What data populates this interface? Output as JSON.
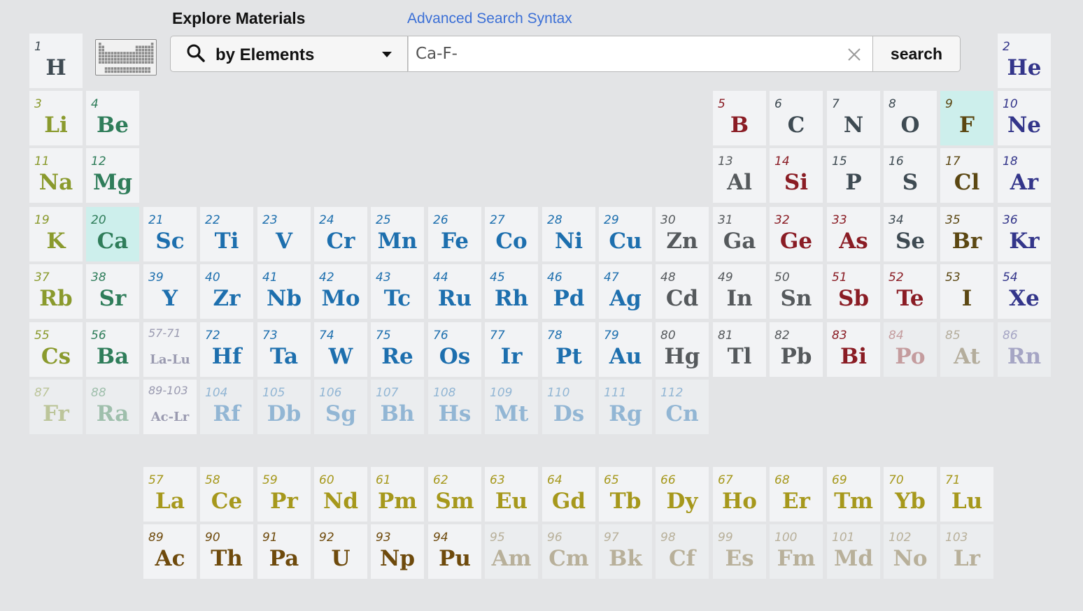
{
  "header": {
    "title": "Explore Materials",
    "advanced_link": "Advanced Search Syntax"
  },
  "search": {
    "mode_label": "by Elements",
    "query": "Ca-F-",
    "button_label": "search"
  },
  "colors": {
    "selected_bg": "#cdefec",
    "link": "#3b6fd6"
  },
  "elements": [
    {
      "num": "1",
      "sym": "H",
      "row": 0,
      "col": 0,
      "color": "#3e4a52"
    },
    {
      "num": "2",
      "sym": "He",
      "row": 0,
      "col": 17,
      "color": "#33358a"
    },
    {
      "num": "3",
      "sym": "Li",
      "row": 1,
      "col": 0,
      "color": "#8a9a2d"
    },
    {
      "num": "4",
      "sym": "Be",
      "row": 1,
      "col": 1,
      "color": "#2f7d5a"
    },
    {
      "num": "5",
      "sym": "B",
      "row": 1,
      "col": 12,
      "color": "#8a1c24"
    },
    {
      "num": "6",
      "sym": "C",
      "row": 1,
      "col": 13,
      "color": "#3e4a52"
    },
    {
      "num": "7",
      "sym": "N",
      "row": 1,
      "col": 14,
      "color": "#3e4a52"
    },
    {
      "num": "8",
      "sym": "O",
      "row": 1,
      "col": 15,
      "color": "#3e4a52"
    },
    {
      "num": "9",
      "sym": "F",
      "row": 1,
      "col": 16,
      "color": "#5b4712",
      "selected": true
    },
    {
      "num": "10",
      "sym": "Ne",
      "row": 1,
      "col": 17,
      "color": "#33358a"
    },
    {
      "num": "11",
      "sym": "Na",
      "row": 2,
      "col": 0,
      "color": "#8a9a2d"
    },
    {
      "num": "12",
      "sym": "Mg",
      "row": 2,
      "col": 1,
      "color": "#2f7d5a"
    },
    {
      "num": "13",
      "sym": "Al",
      "row": 2,
      "col": 12,
      "color": "#55595c"
    },
    {
      "num": "14",
      "sym": "Si",
      "row": 2,
      "col": 13,
      "color": "#8a1c24"
    },
    {
      "num": "15",
      "sym": "P",
      "row": 2,
      "col": 14,
      "color": "#3e4a52"
    },
    {
      "num": "16",
      "sym": "S",
      "row": 2,
      "col": 15,
      "color": "#3e4a52"
    },
    {
      "num": "17",
      "sym": "Cl",
      "row": 2,
      "col": 16,
      "color": "#5b4712"
    },
    {
      "num": "18",
      "sym": "Ar",
      "row": 2,
      "col": 17,
      "color": "#33358a"
    },
    {
      "num": "19",
      "sym": "K",
      "row": 3,
      "col": 0,
      "color": "#8a9a2d"
    },
    {
      "num": "20",
      "sym": "Ca",
      "row": 3,
      "col": 1,
      "color": "#2f7d5a",
      "selected": true
    },
    {
      "num": "21",
      "sym": "Sc",
      "row": 3,
      "col": 2,
      "color": "#1d6fae"
    },
    {
      "num": "22",
      "sym": "Ti",
      "row": 3,
      "col": 3,
      "color": "#1d6fae"
    },
    {
      "num": "23",
      "sym": "V",
      "row": 3,
      "col": 4,
      "color": "#1d6fae"
    },
    {
      "num": "24",
      "sym": "Cr",
      "row": 3,
      "col": 5,
      "color": "#1d6fae"
    },
    {
      "num": "25",
      "sym": "Mn",
      "row": 3,
      "col": 6,
      "color": "#1d6fae"
    },
    {
      "num": "26",
      "sym": "Fe",
      "row": 3,
      "col": 7,
      "color": "#1d6fae"
    },
    {
      "num": "27",
      "sym": "Co",
      "row": 3,
      "col": 8,
      "color": "#1d6fae"
    },
    {
      "num": "28",
      "sym": "Ni",
      "row": 3,
      "col": 9,
      "color": "#1d6fae"
    },
    {
      "num": "29",
      "sym": "Cu",
      "row": 3,
      "col": 10,
      "color": "#1d6fae"
    },
    {
      "num": "30",
      "sym": "Zn",
      "row": 3,
      "col": 11,
      "color": "#55595c"
    },
    {
      "num": "31",
      "sym": "Ga",
      "row": 3,
      "col": 12,
      "color": "#55595c"
    },
    {
      "num": "32",
      "sym": "Ge",
      "row": 3,
      "col": 13,
      "color": "#8a1c24"
    },
    {
      "num": "33",
      "sym": "As",
      "row": 3,
      "col": 14,
      "color": "#8a1c24"
    },
    {
      "num": "34",
      "sym": "Se",
      "row": 3,
      "col": 15,
      "color": "#3e4a52"
    },
    {
      "num": "35",
      "sym": "Br",
      "row": 3,
      "col": 16,
      "color": "#5b4712"
    },
    {
      "num": "36",
      "sym": "Kr",
      "row": 3,
      "col": 17,
      "color": "#33358a"
    },
    {
      "num": "37",
      "sym": "Rb",
      "row": 4,
      "col": 0,
      "color": "#8a9a2d"
    },
    {
      "num": "38",
      "sym": "Sr",
      "row": 4,
      "col": 1,
      "color": "#2f7d5a"
    },
    {
      "num": "39",
      "sym": "Y",
      "row": 4,
      "col": 2,
      "color": "#1d6fae"
    },
    {
      "num": "40",
      "sym": "Zr",
      "row": 4,
      "col": 3,
      "color": "#1d6fae"
    },
    {
      "num": "41",
      "sym": "Nb",
      "row": 4,
      "col": 4,
      "color": "#1d6fae"
    },
    {
      "num": "42",
      "sym": "Mo",
      "row": 4,
      "col": 5,
      "color": "#1d6fae"
    },
    {
      "num": "43",
      "sym": "Tc",
      "row": 4,
      "col": 6,
      "color": "#1d6fae"
    },
    {
      "num": "44",
      "sym": "Ru",
      "row": 4,
      "col": 7,
      "color": "#1d6fae"
    },
    {
      "num": "45",
      "sym": "Rh",
      "row": 4,
      "col": 8,
      "color": "#1d6fae"
    },
    {
      "num": "46",
      "sym": "Pd",
      "row": 4,
      "col": 9,
      "color": "#1d6fae"
    },
    {
      "num": "47",
      "sym": "Ag",
      "row": 4,
      "col": 10,
      "color": "#1d6fae"
    },
    {
      "num": "48",
      "sym": "Cd",
      "row": 4,
      "col": 11,
      "color": "#55595c"
    },
    {
      "num": "49",
      "sym": "In",
      "row": 4,
      "col": 12,
      "color": "#55595c"
    },
    {
      "num": "50",
      "sym": "Sn",
      "row": 4,
      "col": 13,
      "color": "#55595c"
    },
    {
      "num": "51",
      "sym": "Sb",
      "row": 4,
      "col": 14,
      "color": "#8a1c24"
    },
    {
      "num": "52",
      "sym": "Te",
      "row": 4,
      "col": 15,
      "color": "#8a1c24"
    },
    {
      "num": "53",
      "sym": "I",
      "row": 4,
      "col": 16,
      "color": "#5b4712"
    },
    {
      "num": "54",
      "sym": "Xe",
      "row": 4,
      "col": 17,
      "color": "#33358a"
    },
    {
      "num": "55",
      "sym": "Cs",
      "row": 5,
      "col": 0,
      "color": "#8a9a2d"
    },
    {
      "num": "56",
      "sym": "Ba",
      "row": 5,
      "col": 1,
      "color": "#2f7d5a"
    },
    {
      "num": "57-71",
      "sym": "La-Lu",
      "row": 5,
      "col": 2,
      "color": "#9a9ab0",
      "range": true
    },
    {
      "num": "72",
      "sym": "Hf",
      "row": 5,
      "col": 3,
      "color": "#1d6fae"
    },
    {
      "num": "73",
      "sym": "Ta",
      "row": 5,
      "col": 4,
      "color": "#1d6fae"
    },
    {
      "num": "74",
      "sym": "W",
      "row": 5,
      "col": 5,
      "color": "#1d6fae"
    },
    {
      "num": "75",
      "sym": "Re",
      "row": 5,
      "col": 6,
      "color": "#1d6fae"
    },
    {
      "num": "76",
      "sym": "Os",
      "row": 5,
      "col": 7,
      "color": "#1d6fae"
    },
    {
      "num": "77",
      "sym": "Ir",
      "row": 5,
      "col": 8,
      "color": "#1d6fae"
    },
    {
      "num": "78",
      "sym": "Pt",
      "row": 5,
      "col": 9,
      "color": "#1d6fae"
    },
    {
      "num": "79",
      "sym": "Au",
      "row": 5,
      "col": 10,
      "color": "#1d6fae"
    },
    {
      "num": "80",
      "sym": "Hg",
      "row": 5,
      "col": 11,
      "color": "#55595c"
    },
    {
      "num": "81",
      "sym": "Tl",
      "row": 5,
      "col": 12,
      "color": "#55595c"
    },
    {
      "num": "82",
      "sym": "Pb",
      "row": 5,
      "col": 13,
      "color": "#55595c"
    },
    {
      "num": "83",
      "sym": "Bi",
      "row": 5,
      "col": 14,
      "color": "#8a1c24"
    },
    {
      "num": "84",
      "sym": "Po",
      "row": 5,
      "col": 15,
      "color": "#c49c9e",
      "faded": true
    },
    {
      "num": "85",
      "sym": "At",
      "row": 5,
      "col": 16,
      "color": "#b4ad9c",
      "faded": true
    },
    {
      "num": "86",
      "sym": "Rn",
      "row": 5,
      "col": 17,
      "color": "#a5a5c4",
      "faded": true
    },
    {
      "num": "87",
      "sym": "Fr",
      "row": 6,
      "col": 0,
      "color": "#bcc59a",
      "faded": true
    },
    {
      "num": "88",
      "sym": "Ra",
      "row": 6,
      "col": 1,
      "color": "#9fbfac",
      "faded": true
    },
    {
      "num": "89-103",
      "sym": "Ac-Lr",
      "row": 6,
      "col": 2,
      "color": "#9a9ab0",
      "range": true
    },
    {
      "num": "104",
      "sym": "Rf",
      "row": 6,
      "col": 3,
      "color": "#92b6d4",
      "faded": true
    },
    {
      "num": "105",
      "sym": "Db",
      "row": 6,
      "col": 4,
      "color": "#92b6d4",
      "faded": true
    },
    {
      "num": "106",
      "sym": "Sg",
      "row": 6,
      "col": 5,
      "color": "#92b6d4",
      "faded": true
    },
    {
      "num": "107",
      "sym": "Bh",
      "row": 6,
      "col": 6,
      "color": "#92b6d4",
      "faded": true
    },
    {
      "num": "108",
      "sym": "Hs",
      "row": 6,
      "col": 7,
      "color": "#92b6d4",
      "faded": true
    },
    {
      "num": "109",
      "sym": "Mt",
      "row": 6,
      "col": 8,
      "color": "#92b6d4",
      "faded": true
    },
    {
      "num": "110",
      "sym": "Ds",
      "row": 6,
      "col": 9,
      "color": "#92b6d4",
      "faded": true
    },
    {
      "num": "111",
      "sym": "Rg",
      "row": 6,
      "col": 10,
      "color": "#92b6d4",
      "faded": true
    },
    {
      "num": "112",
      "sym": "Cn",
      "row": 6,
      "col": 11,
      "color": "#92b6d4",
      "faded": true
    },
    {
      "num": "57",
      "sym": "La",
      "row": 8,
      "col": 2,
      "color": "#a6981c"
    },
    {
      "num": "58",
      "sym": "Ce",
      "row": 8,
      "col": 3,
      "color": "#a6981c"
    },
    {
      "num": "59",
      "sym": "Pr",
      "row": 8,
      "col": 4,
      "color": "#a6981c"
    },
    {
      "num": "60",
      "sym": "Nd",
      "row": 8,
      "col": 5,
      "color": "#a6981c"
    },
    {
      "num": "61",
      "sym": "Pm",
      "row": 8,
      "col": 6,
      "color": "#a6981c"
    },
    {
      "num": "62",
      "sym": "Sm",
      "row": 8,
      "col": 7,
      "color": "#a6981c"
    },
    {
      "num": "63",
      "sym": "Eu",
      "row": 8,
      "col": 8,
      "color": "#a6981c"
    },
    {
      "num": "64",
      "sym": "Gd",
      "row": 8,
      "col": 9,
      "color": "#a6981c"
    },
    {
      "num": "65",
      "sym": "Tb",
      "row": 8,
      "col": 10,
      "color": "#a6981c"
    },
    {
      "num": "66",
      "sym": "Dy",
      "row": 8,
      "col": 11,
      "color": "#a6981c"
    },
    {
      "num": "67",
      "sym": "Ho",
      "row": 8,
      "col": 12,
      "color": "#a6981c"
    },
    {
      "num": "68",
      "sym": "Er",
      "row": 8,
      "col": 13,
      "color": "#a6981c"
    },
    {
      "num": "69",
      "sym": "Tm",
      "row": 8,
      "col": 14,
      "color": "#a6981c"
    },
    {
      "num": "70",
      "sym": "Yb",
      "row": 8,
      "col": 15,
      "color": "#a6981c"
    },
    {
      "num": "71",
      "sym": "Lu",
      "row": 8,
      "col": 16,
      "color": "#a6981c"
    },
    {
      "num": "89",
      "sym": "Ac",
      "row": 9,
      "col": 2,
      "color": "#6e4a0c"
    },
    {
      "num": "90",
      "sym": "Th",
      "row": 9,
      "col": 3,
      "color": "#6e4a0c"
    },
    {
      "num": "91",
      "sym": "Pa",
      "row": 9,
      "col": 4,
      "color": "#6e4a0c"
    },
    {
      "num": "92",
      "sym": "U",
      "row": 9,
      "col": 5,
      "color": "#6e4a0c"
    },
    {
      "num": "93",
      "sym": "Np",
      "row": 9,
      "col": 6,
      "color": "#6e4a0c"
    },
    {
      "num": "94",
      "sym": "Pu",
      "row": 9,
      "col": 7,
      "color": "#6e4a0c"
    },
    {
      "num": "95",
      "sym": "Am",
      "row": 9,
      "col": 8,
      "color": "#b8b09a",
      "faded": true
    },
    {
      "num": "96",
      "sym": "Cm",
      "row": 9,
      "col": 9,
      "color": "#b8b09a",
      "faded": true
    },
    {
      "num": "97",
      "sym": "Bk",
      "row": 9,
      "col": 10,
      "color": "#b8b09a",
      "faded": true
    },
    {
      "num": "98",
      "sym": "Cf",
      "row": 9,
      "col": 11,
      "color": "#b8b09a",
      "faded": true
    },
    {
      "num": "99",
      "sym": "Es",
      "row": 9,
      "col": 12,
      "color": "#b8b09a",
      "faded": true
    },
    {
      "num": "100",
      "sym": "Fm",
      "row": 9,
      "col": 13,
      "color": "#b8b09a",
      "faded": true
    },
    {
      "num": "101",
      "sym": "Md",
      "row": 9,
      "col": 14,
      "color": "#b8b09a",
      "faded": true
    },
    {
      "num": "102",
      "sym": "No",
      "row": 9,
      "col": 15,
      "color": "#b8b09a",
      "faded": true
    },
    {
      "num": "103",
      "sym": "Lr",
      "row": 9,
      "col": 16,
      "color": "#b8b09a",
      "faded": true
    }
  ]
}
